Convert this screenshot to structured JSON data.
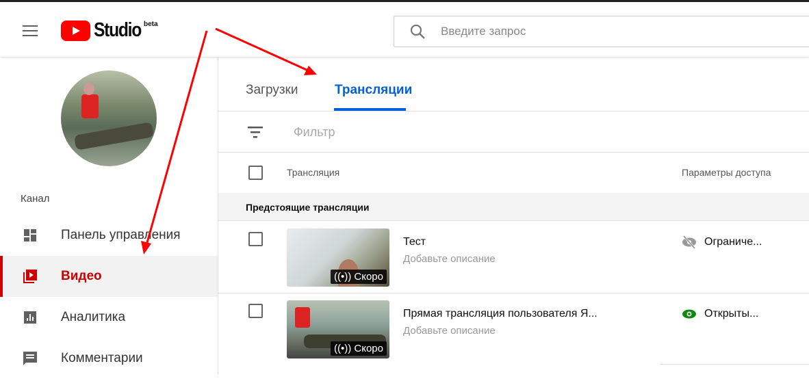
{
  "header": {
    "logo_text": "Studio",
    "logo_badge": "beta",
    "search_placeholder": "Введите запрос"
  },
  "sidebar": {
    "section": "Канал",
    "items": [
      {
        "label": "Панель управления",
        "icon": "dashboard-icon"
      },
      {
        "label": "Видео",
        "icon": "video-icon",
        "active": true
      },
      {
        "label": "Аналитика",
        "icon": "analytics-icon"
      },
      {
        "label": "Комментарии",
        "icon": "comments-icon"
      }
    ]
  },
  "main": {
    "tabs": [
      {
        "label": "Загрузки"
      },
      {
        "label": "Трансляции",
        "active": true
      }
    ],
    "filter_placeholder": "Фильтр",
    "columns": {
      "stream": "Трансляция",
      "access": "Параметры доступа"
    },
    "section": "Предстоящие трансляции",
    "rows": [
      {
        "title": "Тест",
        "description": "Добавьте описание",
        "badge": "Скоро",
        "access": "Ограниче...",
        "access_icon": "eye-off-icon"
      },
      {
        "title": "Прямая трансляция пользователя Я...",
        "description": "Добавьте описание",
        "badge": "Скоро",
        "access": "Открыты...",
        "access_icon": "eye-icon"
      }
    ]
  },
  "colors": {
    "accent": "#065fd4",
    "active": "#cc0000",
    "public": "#0f8a0f",
    "annotation": "#ff0000"
  }
}
